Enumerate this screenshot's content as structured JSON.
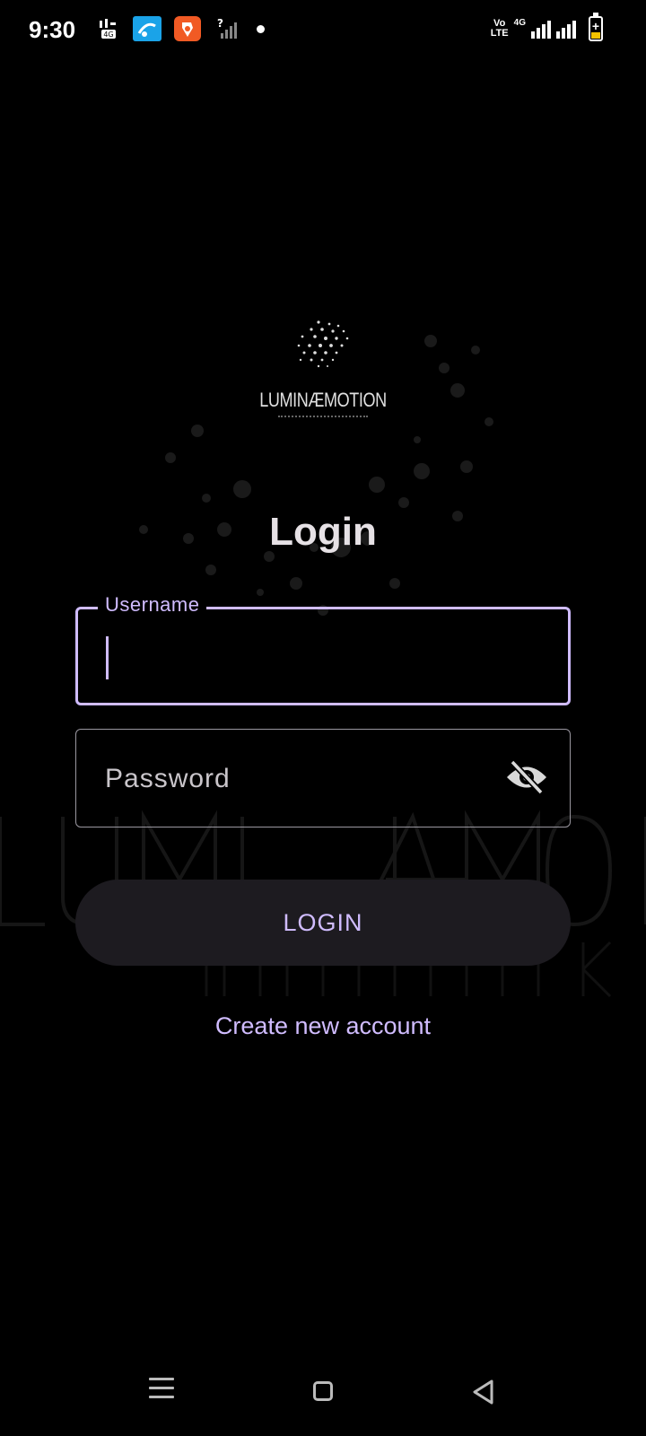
{
  "status_bar": {
    "time": "9:30",
    "left_icons": [
      "jazz-4g-icon",
      "telenor-icon",
      "app-notification-icon",
      "no-sim-signal-icon",
      "dot-icon"
    ],
    "volte": [
      "Vo",
      "LTE"
    ],
    "network_type": "4G",
    "battery_icon": "battery-charging-icon"
  },
  "logo": {
    "wordmark": "LUMINÆMOTION"
  },
  "login_form": {
    "title": "Login",
    "username": {
      "label": "Username",
      "value": ""
    },
    "password": {
      "placeholder": "Password",
      "toggle_icon": "eye-off-icon"
    },
    "login_button": "LOGIN",
    "create_account_link": "Create new account"
  },
  "colors": {
    "accent": "#d0bcff",
    "background": "#000000",
    "button_bg": "#1d1b20",
    "title": "#e6e1e5"
  },
  "nav_bar": {
    "icons": [
      "recents-menu-icon",
      "home-icon",
      "back-icon"
    ]
  }
}
